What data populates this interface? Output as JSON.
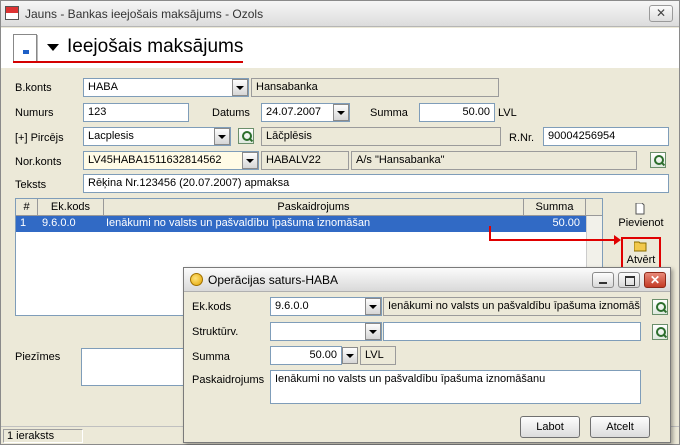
{
  "window": {
    "title": "Jauns - Bankas ieejošais maksājums - Ozols",
    "close_glyph": "✕"
  },
  "header": {
    "page_title": "Ieejošais maksājums"
  },
  "form": {
    "bkonts": {
      "label": "B.konts",
      "value": "HABA",
      "bank_name": "Hansabanka"
    },
    "numurs": {
      "label": "Numurs",
      "value": "123"
    },
    "datums": {
      "label": "Datums",
      "value": "24.07.2007"
    },
    "summa": {
      "label": "Summa",
      "value": "50.00",
      "currency": "LVL"
    },
    "pircejs": {
      "label": "[+] Pircējs",
      "value": "Lacplesis",
      "name": "Lāčplēsis"
    },
    "rnr": {
      "label": "R.Nr.",
      "value": "90004256954"
    },
    "nor_konts": {
      "label": "Nor.konts",
      "value": "LV45HABA1511632814562",
      "swift": "HABALV22",
      "bank": "A/s \"Hansabanka\""
    },
    "teksts": {
      "label": "Teksts",
      "value": "Rēķina Nr.123456 (20.07.2007) apmaksa"
    },
    "piezimes": {
      "label": "Piezīmes"
    }
  },
  "grid": {
    "columns": [
      "#",
      "Ek.kods",
      "Paskaidrojums",
      "Summa"
    ],
    "rows": [
      {
        "num": "1",
        "ek_kods": "9.6.0.0",
        "paskaidrojums": "Ienākumi no valsts un pašvaldību īpašuma iznomāšan",
        "summa": "50.00"
      }
    ]
  },
  "side_buttons": {
    "add": "Pievienot",
    "open": "Atvērt"
  },
  "status": {
    "records": "1 ieraksts"
  },
  "dialog": {
    "title": "Operācijas saturs-HABA",
    "ek_kods": {
      "label": "Ek.kods",
      "value": "9.6.0.0",
      "desc": "Ienākumi no valsts un pašvaldību īpašuma iznomāšan"
    },
    "strukturv": {
      "label": "Struktūrv.",
      "value": "",
      "desc": ""
    },
    "summa": {
      "label": "Summa",
      "value": "50.00",
      "currency": "LVL"
    },
    "paskaidrojums": {
      "label": "Paskaidrojums",
      "value": "Ienākumi no valsts un pašvaldību īpašuma iznomāšanu"
    },
    "buttons": {
      "ok": "Labot",
      "cancel": "Atcelt"
    },
    "close_glyph": "✕"
  },
  "colors": {
    "accent_red": "#e00000",
    "selection_blue": "#316ac5"
  }
}
